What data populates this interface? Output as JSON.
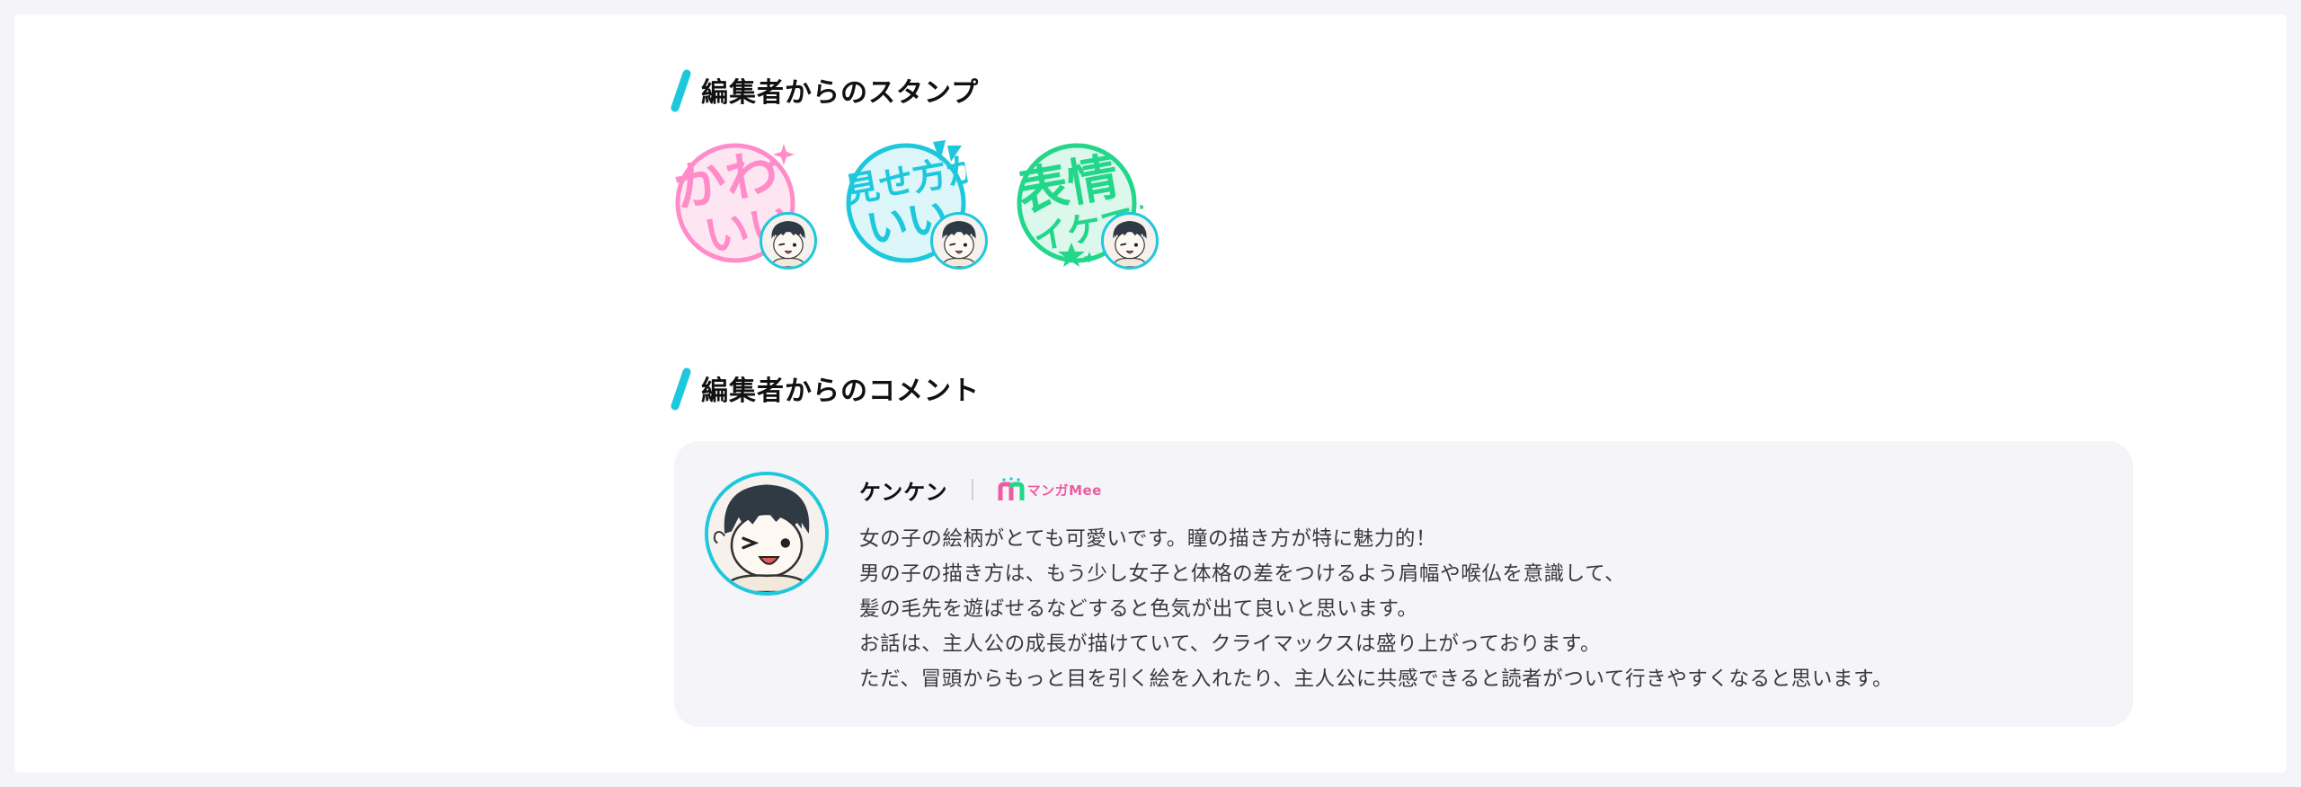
{
  "colors": {
    "accent": "#1ec8dc",
    "pink": "#ff8cc8",
    "cyan": "#1ec8dc",
    "green": "#22d68a",
    "card_bg": "#f4f4f9",
    "brand": "#ef5aa0"
  },
  "stamps_section": {
    "title": "編集者からのスタンプ",
    "stamps": [
      {
        "text": "かわいい",
        "line1": "かわ",
        "line2": "いい",
        "color": "#ff8cc8",
        "icon": "sparkle-icon"
      },
      {
        "text": "見せ方がいい",
        "line1": "見せ方が",
        "line2": "いい",
        "color": "#1ec8dc",
        "icon": "flag-icon"
      },
      {
        "text": "表情イケてる",
        "line1": "表情",
        "line2": "イケてる",
        "color": "#22d68a",
        "icon": "star-icon"
      }
    ]
  },
  "comments_section": {
    "title": "編集者からのコメント",
    "comment": {
      "author": "ケンケン",
      "brand_label": "マンガMee",
      "lines": [
        "女の子の絵柄がとても可愛いです。瞳の描き方が特に魅力的！",
        "男の子の描き方は、もう少し女子と体格の差をつけるよう肩幅や喉仏を意識して、",
        "髪の毛先を遊ばせるなどすると色気が出て良いと思います。",
        "お話は、主人公の成長が描けていて、クライマックスは盛り上がっております。",
        "ただ、冒頭からもっと目を引く絵を入れたり、主人公に共感できると読者がついて行きやすくなると思います。"
      ]
    }
  }
}
